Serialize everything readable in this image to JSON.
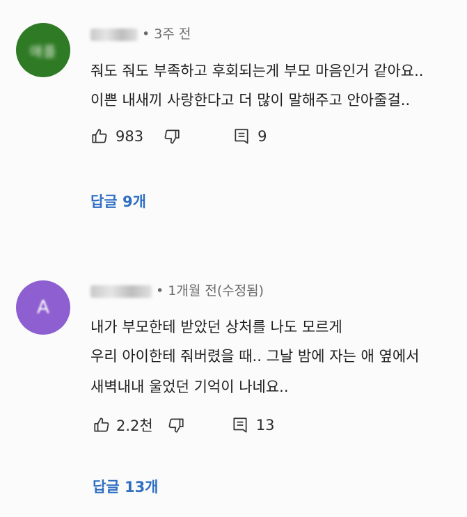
{
  "comments": [
    {
      "avatar_color": "#2f7a24",
      "avatar_text": "애플",
      "time": "• 3주 전",
      "lines": [
        "줘도 줘도 부족하고 후회되는게 부모 마음인거 같아요..",
        "이쁜 내새끼 사랑한다고 더 많이 말해주고 안아줄걸.."
      ],
      "likes": "983",
      "reply_count": "9",
      "replies_label": "답글 9개"
    },
    {
      "avatar_color": "#8e5fd0",
      "avatar_text": "A",
      "time": "• 1개월 전(수정됨)",
      "lines": [
        "내가 부모한테 받았던 상처를 나도 모르게",
        "우리 아이한테 줘버렸을 때.. 그날 밤에 자는 애 옆에서",
        "새벽내내 울었던 기억이 나네요.."
      ],
      "likes": "2.2천",
      "reply_count": "13",
      "replies_label": "답글 13개"
    }
  ]
}
